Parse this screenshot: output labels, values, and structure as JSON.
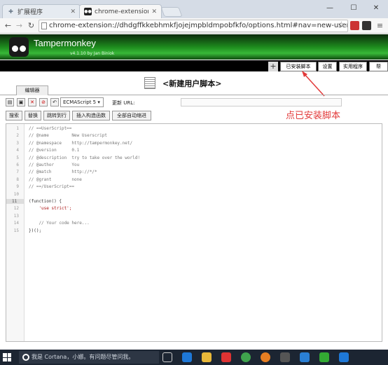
{
  "browser": {
    "tabs": [
      {
        "label": "扩展程序",
        "icon": "puzzle-icon"
      },
      {
        "label": "chrome-extension://dh",
        "icon": "tampermonkey-icon"
      }
    ],
    "url": "chrome-extension://dhdgffkkebhmkfjojejmpbldmpobfkfo/options.html#nav=new-user-script",
    "window_controls": [
      "—",
      "☐",
      "✕"
    ]
  },
  "tampermonkey": {
    "title": "Tampermonkey",
    "version": "v4.1.10 by Jan Biniok",
    "nav": [
      "已安装脚本",
      "设置",
      "实用程序",
      "帮"
    ],
    "add": "+"
  },
  "page": {
    "title": "<新建用户脚本>",
    "annotation": "点已安装脚本",
    "annotation_color": "#e23a3a"
  },
  "editor": {
    "tab": "编辑器",
    "language": "ECMAScript 5 ▾",
    "update_url_label": "更新 URL:",
    "buttons": [
      "搜索",
      "替换",
      "跳转到行",
      "插入构造函数",
      "全部自动缩进"
    ],
    "current_line": "11",
    "lines": [
      "// ==UserScript==",
      "// @name         New Userscript",
      "// @namespace    http://tampermonkey.net/",
      "// @version      0.1",
      "// @description  try to take over the world!",
      "// @author       You",
      "// @match        http://*/*",
      "// @grant        none",
      "// ==/UserScript==",
      "",
      "(function() {",
      "    'use strict';",
      "",
      "    // Your code here...",
      "})();"
    ]
  },
  "taskbar": {
    "search_placeholder": "我是 Cortana，小娜。有问题尽管问我。"
  }
}
